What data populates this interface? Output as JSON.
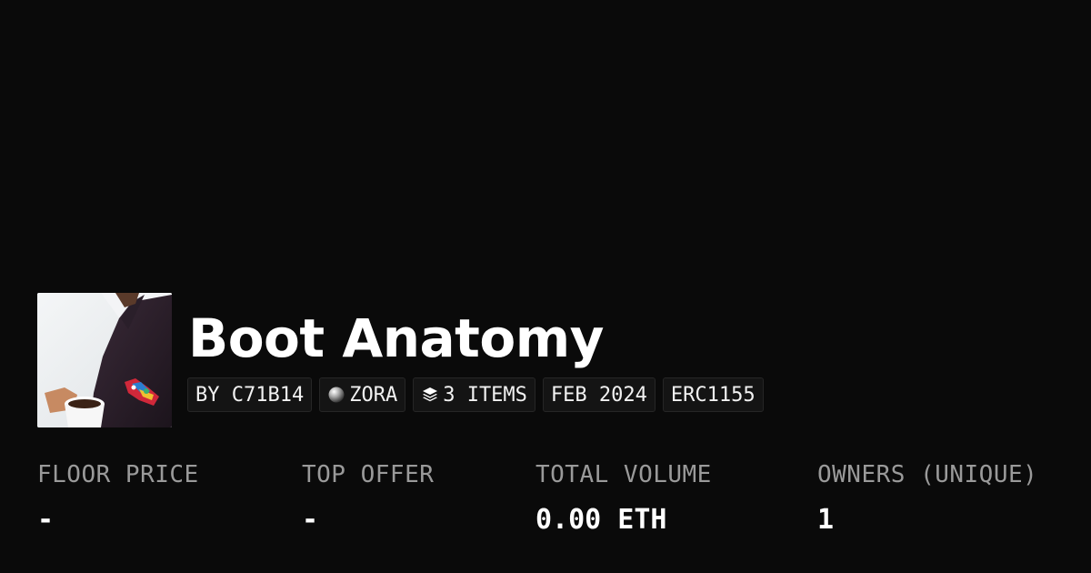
{
  "collection": {
    "title": "Boot Anatomy"
  },
  "chips": {
    "creator": "BY C71B14",
    "network": "ZORA",
    "items": "3 ITEMS",
    "date": "FEB 2024",
    "standard": "ERC1155"
  },
  "icons": {
    "network": "zora-orb-icon",
    "items": "layers-icon"
  },
  "stats": {
    "floor_price": {
      "label": "FLOOR PRICE",
      "value": "-"
    },
    "top_offer": {
      "label": "TOP OFFER",
      "value": "-"
    },
    "total_volume": {
      "label": "TOTAL VOLUME",
      "value": "0.00 ETH"
    },
    "owners": {
      "label": "OWNERS (UNIQUE)",
      "value": "1"
    }
  },
  "colors": {
    "background": "#0a0a0a",
    "text": "#ffffff",
    "muted": "#9a9a9a",
    "chip_bg": "#141414",
    "chip_border": "#262626"
  }
}
